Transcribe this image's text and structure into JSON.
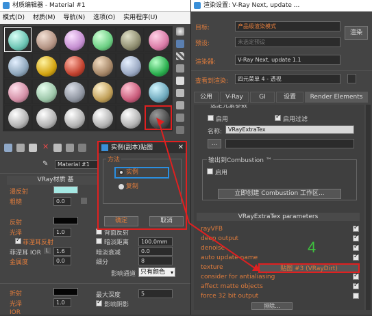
{
  "left_window": {
    "title": "材质编辑器 - Material #1",
    "menu": [
      "模式(D)",
      "材质(M)",
      "导航(N)",
      "选项(O)",
      "实用程序(U)"
    ],
    "material_name": "Material #1",
    "rollout_title": "VRay材质 基",
    "params": {
      "diffuse": "漫反射",
      "roughness": "粗糙",
      "roughness_val": "0.0",
      "reflect": "反射",
      "gloss": "光泽",
      "gloss_val": "1.0",
      "fresnel": "菲涅耳反射",
      "fresnel_ior": "菲涅耳 IOR",
      "fresnel_ior_key": "L",
      "fresnel_ior_val": "1.6",
      "metalness": "金属度",
      "metalness_val": "0.0",
      "refract": "折射",
      "refract_gloss": "光泽",
      "refract_gloss_val": "1.0",
      "ior": "IOR",
      "bg_reflect": "背面反射",
      "dim_distance": "暗淡距离",
      "dim_val": "100.0mm",
      "dim_falloff": "暗淡衰减",
      "dim_falloff_val": "0.0",
      "subdivs": "细分",
      "subdivs_val": "8",
      "affect_channels": "影响通道",
      "affect_channels_val": "只有颜色",
      "max_depth": "最大深度",
      "max_depth_val": "5",
      "affect_shadows": "影响阴影"
    }
  },
  "dialog": {
    "title": "实例(副本)贴图",
    "group": "方法",
    "instance": "实例",
    "copy": "复制",
    "ok": "确定",
    "cancel": "取消"
  },
  "right_window": {
    "title": "渲染设置: V-Ray Next, update ...",
    "target_label": "目标:",
    "target_val": "产品级渲染模式",
    "preset_label": "预设:",
    "preset_val": "未选定预设",
    "renderer_label": "渲染器:",
    "renderer_val": "V-Ray Next, update 1.1",
    "view_label": "查看到渲染:",
    "view_val": "四元菜单 4 - 透视",
    "render_btn": "渲染",
    "tabs": [
      "公用",
      "V-Ray",
      "GI",
      "设置",
      "Render Elements"
    ],
    "cut_header": "选定元素参数",
    "enable1": "启用",
    "enable_filter": "启用过滤",
    "name_label": "名称:",
    "name_val": "VRayExtraTex",
    "dots": "...",
    "combustion": "输出到Combustion ™",
    "enable2": "启用",
    "create_combustion": "立即创建 Combustion 工作区...",
    "params_title": "VRayExtraTex parameters",
    "rows": [
      "rayVFB",
      "deep output",
      "denoise",
      "auto update name",
      "texture",
      "consider for antialiasing",
      "affect matte objects",
      "force 32 bit output"
    ],
    "texture_btn": "贴图 #3 (VRayDirt)",
    "bottom": "排除...",
    "annotation": "4"
  },
  "colors": {
    "accent": "#e07c3c",
    "red": "#e02020",
    "highlight_blue": "#2b8fe0",
    "green_number": "#3ec13e"
  }
}
